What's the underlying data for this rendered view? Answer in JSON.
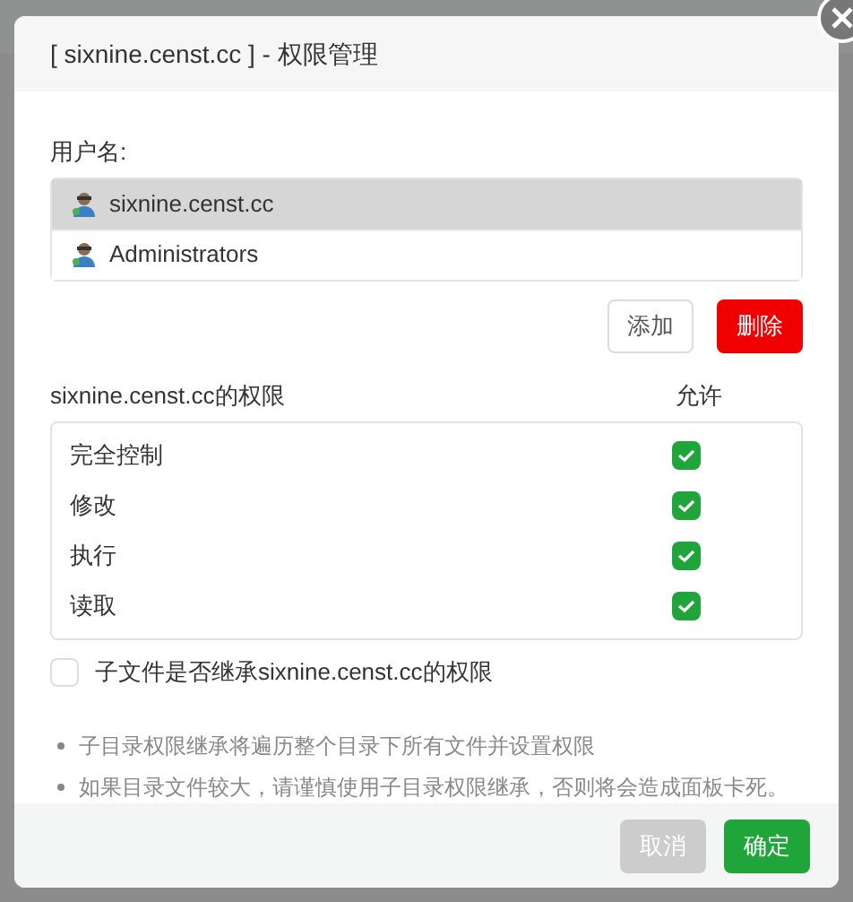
{
  "dialog": {
    "title": "[ sixnine.censt.cc ] - 权限管理"
  },
  "users": {
    "label": "用户名:",
    "items": [
      {
        "name": "sixnine.censt.cc",
        "selected": true
      },
      {
        "name": "Administrators",
        "selected": false
      }
    ]
  },
  "user_buttons": [
    {
      "label": "添加",
      "kind": "default"
    },
    {
      "label": "删除",
      "kind": "danger"
    }
  ],
  "permissions": {
    "title": "sixnine.censt.cc的权限",
    "allow_header": "允许",
    "rows": [
      {
        "name": "完全控制",
        "checked": true
      },
      {
        "name": "修改",
        "checked": true
      },
      {
        "name": "执行",
        "checked": true
      },
      {
        "name": "读取",
        "checked": true
      }
    ]
  },
  "inherit": {
    "label": "子文件是否继承sixnine.censt.cc的权限",
    "checked": false
  },
  "notes": [
    "子目录权限继承将遍历整个目录下所有文件并设置权限",
    "如果目录文件较大，请谨慎使用子目录权限继承，否则将会造成面板卡死。"
  ],
  "footer_buttons": [
    {
      "label": "取消",
      "disabled": true
    },
    {
      "label": "确定",
      "disabled": false
    }
  ]
}
